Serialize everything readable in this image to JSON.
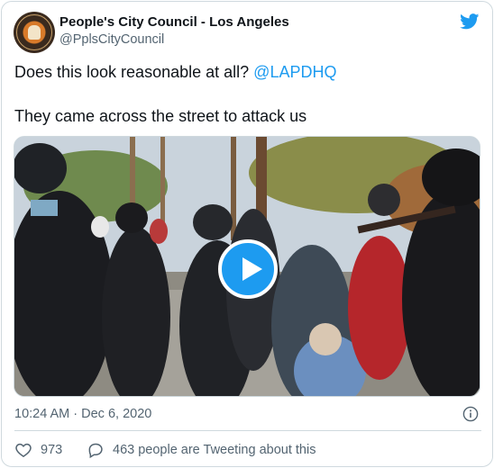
{
  "tweet": {
    "author_name": "People's City Council - Los Angeles",
    "author_handle": "@PplsCityCouncil",
    "text_line1": "Does this look reasonable at all? ",
    "mention": "@LAPDHQ",
    "text_line2": "They came across the street to attack us",
    "timestamp": "10:24 AM · Dec 6, 2020",
    "like_count": "973",
    "reply_text": "463 people are Tweeting about this"
  },
  "icons": {
    "brand": "twitter-bird-icon",
    "play": "play-icon",
    "info": "info-icon",
    "like": "heart-icon",
    "reply": "speech-bubble-icon"
  },
  "colors": {
    "accent": "#1d9bf0",
    "secondary_text": "#536471",
    "primary_text": "#0f1419"
  }
}
